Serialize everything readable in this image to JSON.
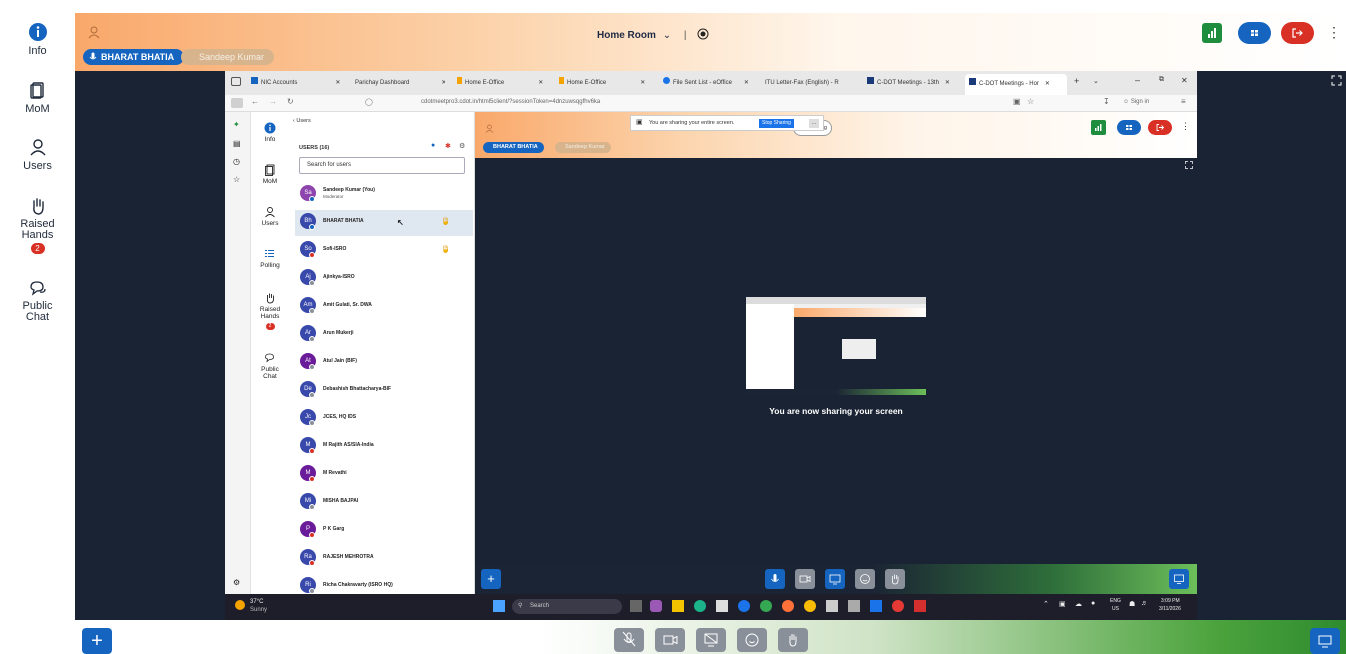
{
  "rail": {
    "items": [
      {
        "label": "Info",
        "icon": "info-icon"
      },
      {
        "label": "MoM",
        "icon": "document-icon"
      },
      {
        "label": "Users",
        "icon": "user-icon"
      },
      {
        "label": "Raised Hands",
        "icon": "hand-icon",
        "badge": "2"
      },
      {
        "label": "Public Chat",
        "icon": "chat-icon"
      }
    ]
  },
  "header": {
    "room_title": "Home Room",
    "presenter": "BHARAT BHATIA",
    "other_user": "Sandeep Kumar"
  },
  "browser": {
    "tabs": [
      "NIC Accounts",
      "Parichay Dashboard",
      "Home E-Office",
      "Home E-Office",
      "File Sent List - eOffice",
      "ITU Letter-Fax (English) - R",
      "C-DOT Meetings - 13th",
      "C-DOT Meetings - Hor"
    ],
    "url": "cdotmeetpro3.cdot.in/html5client/?sessionToken=4dnzuwsqgfhv6ka",
    "sign_in": "Sign in",
    "share_banner": "You are sharing your entire screen.",
    "stop_sharing": "Stop Sharing",
    "recording": "recording"
  },
  "inner": {
    "rail": [
      {
        "label": "Info"
      },
      {
        "label": "MoM"
      },
      {
        "label": "Users"
      },
      {
        "label": "Polling"
      },
      {
        "label": "Raised Hands",
        "badge": "2"
      },
      {
        "label": "Public Chat"
      }
    ],
    "users_back": "Users",
    "users_heading": "USERS (16)",
    "search_placeholder": "Search for users",
    "users": [
      {
        "initials": "Sa",
        "name": "Sandeep Kumar (You)",
        "sub": "Moderator",
        "color": "#8e44ad"
      },
      {
        "initials": "Bh",
        "name": "BHARAT BHATIA",
        "color": "#3949ab",
        "hand": true,
        "highlight": true
      },
      {
        "initials": "So",
        "name": "Sofi-ISRO",
        "color": "#3949ab",
        "hand": true
      },
      {
        "initials": "Aj",
        "name": "Ajinkya-ISRO",
        "color": "#3949ab"
      },
      {
        "initials": "Am",
        "name": "Amit Gulati, Sr. DWA",
        "color": "#3949ab"
      },
      {
        "initials": "Ar",
        "name": "Arun Mukerji",
        "color": "#3949ab"
      },
      {
        "initials": "At",
        "name": "Atul Jain (BIF)",
        "color": "#6a1b9a"
      },
      {
        "initials": "De",
        "name": "Debashish Bhattacharya-BIF",
        "color": "#3949ab"
      },
      {
        "initials": "Jc",
        "name": "JCES, HQ IDS",
        "color": "#3949ab"
      },
      {
        "initials": "M",
        "name": "M Rajith AS/SIA-India",
        "color": "#3949ab"
      },
      {
        "initials": "M",
        "name": "M Revathi",
        "color": "#6a1b9a"
      },
      {
        "initials": "Mi",
        "name": "MISHA BAJPAI",
        "color": "#3949ab"
      },
      {
        "initials": "P",
        "name": "P K Garg",
        "color": "#6a1b9a"
      },
      {
        "initials": "Ra",
        "name": "RAJESH MEHROTRA",
        "color": "#3949ab"
      },
      {
        "initials": "Ri",
        "name": "Richa Chakravarty (ISRO HQ)",
        "color": "#3949ab"
      }
    ],
    "presenter": "BHARAT BHATIA",
    "other_user": "Sandeep Kumar",
    "sharing_caption": "You are now sharing your screen"
  },
  "taskbar": {
    "weather_temp": "37°C",
    "weather_desc": "Sunny",
    "search": "Search",
    "lang": "ENG",
    "region": "US",
    "time": "3:09 PM",
    "date": "3/11/2026"
  },
  "colors": {
    "primary": "#1565c0",
    "danger": "#d93025",
    "success": "#1e8e3e",
    "stage": "#1a2333"
  }
}
